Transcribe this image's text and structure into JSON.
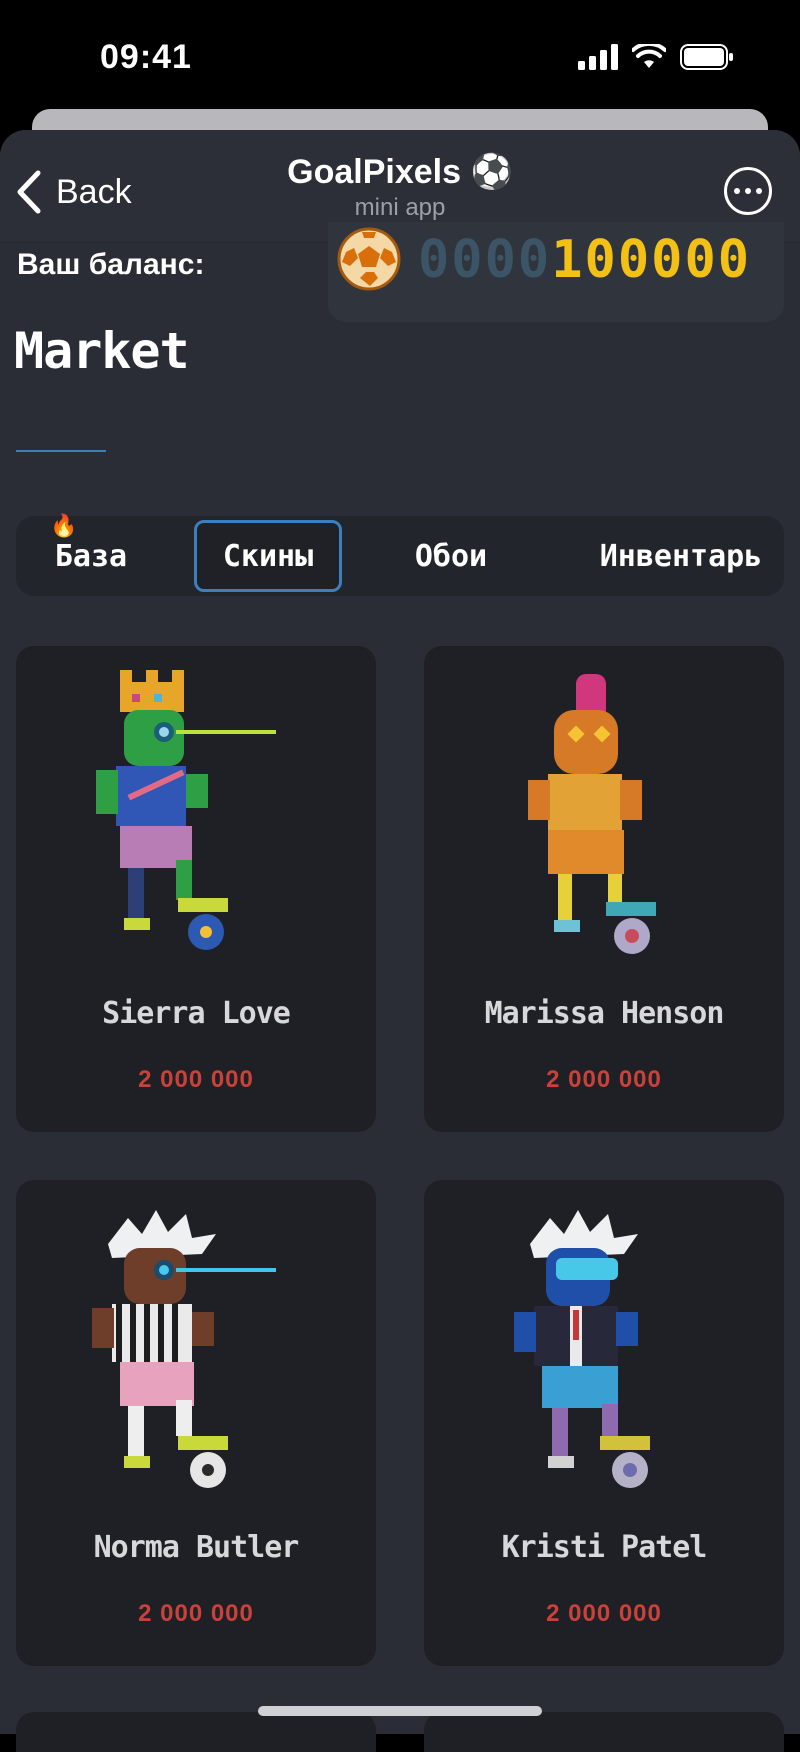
{
  "status_bar": {
    "time": "09:41"
  },
  "header": {
    "back_label": "Back",
    "title": "GoalPixels ⚽",
    "subtitle": "mini app"
  },
  "balance": {
    "label": "Ваш баланс:",
    "digits_dim": "0000",
    "digits_active": "100000"
  },
  "market": {
    "title": "Market",
    "tabs": [
      {
        "label": "База",
        "active": false,
        "badge": "🔥"
      },
      {
        "label": "Скины",
        "active": true
      },
      {
        "label": "Обои",
        "active": false
      },
      {
        "label": "Инвентарь",
        "active": false
      }
    ]
  },
  "items": [
    {
      "name": "Sierra Love",
      "price": "2 000 000"
    },
    {
      "name": "Marissa Henson",
      "price": "2 000 000"
    },
    {
      "name": "Norma Butler",
      "price": "2 000 000"
    },
    {
      "name": "Kristi Patel",
      "price": "2 000 000"
    }
  ],
  "colors": {
    "background": "#2a2d35",
    "card": "#1f2025",
    "price": "#c9423a",
    "accent": "#3b7fbe",
    "balance_active": "#f3c116"
  }
}
